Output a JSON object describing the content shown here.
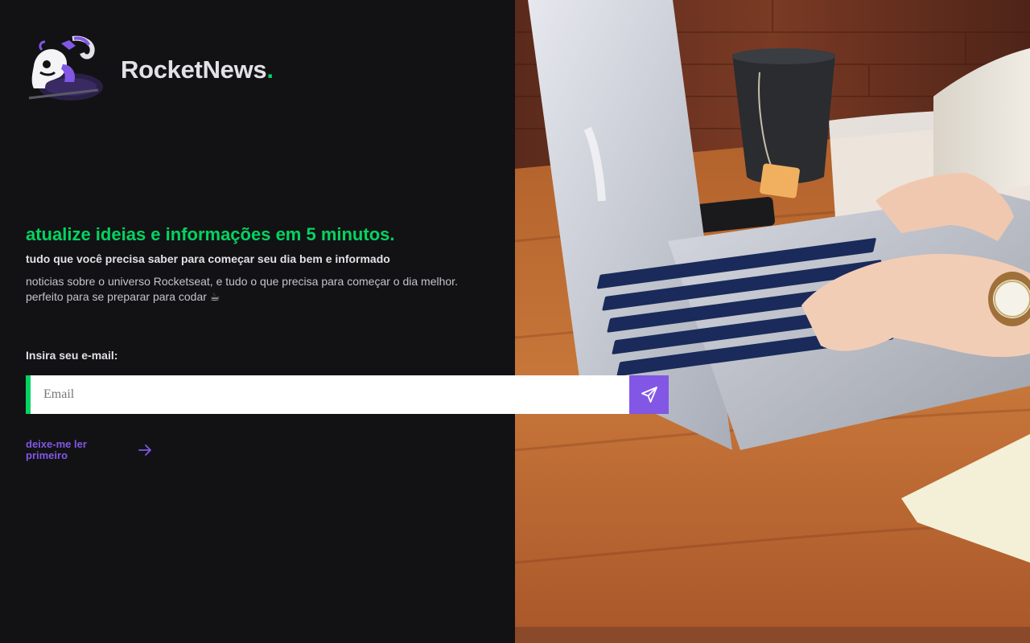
{
  "brand": {
    "name": "RocketNews",
    "dot": ".",
    "accent_color": "#04d361",
    "primary_color": "#8257e5"
  },
  "hero": {
    "headline": "atualize ideias e informações em 5 minutos.",
    "subheadline": "tudo que você precisa saber para começar seu dia bem e informado",
    "description_line1": "noticias sobre o universo Rocketseat, e tudo o que precisa para começar o dia melhor.",
    "description_line2": "perfeito para se preparar para codar ☕"
  },
  "form": {
    "label": "Insira seu e-mail:",
    "email_placeholder": "Email",
    "submit_icon": "paper-plane-icon"
  },
  "read_first": {
    "label": "deixe-me ler primeiro",
    "icon": "arrow-right-icon"
  },
  "photo": {
    "icon": "laptop-typing-photo"
  }
}
